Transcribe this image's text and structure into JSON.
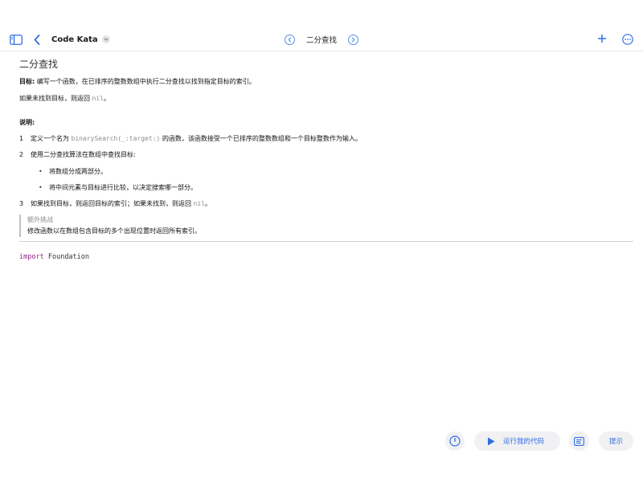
{
  "header": {
    "doc_title": "Code Kata",
    "page_name": "二分查找",
    "icons": [
      "sidebar-icon",
      "back-chevron-icon",
      "dropdown-chevron-icon",
      "previous-page-icon",
      "next-page-icon",
      "plus-icon",
      "more-icon"
    ]
  },
  "content": {
    "title": "二分查找",
    "goal_label": "目标:",
    "goal_text": " 编写一个函数，在已排序的整数数组中执行二分查找以找到指定目标的索引。",
    "not_found_prefix": "如果未找到目标，则返回 ",
    "not_found_code": "nil",
    "not_found_suffix": "。",
    "description_label": "说明:",
    "steps": [
      {
        "num": "1",
        "prefix": "定义一个名为 ",
        "code": "binarySearch(_:target:)",
        "suffix": " 的函数，该函数接受一个已排序的整数数组和一个目标整数作为输入。"
      },
      {
        "num": "2",
        "text": "使用二分查找算法在数组中查找目标:"
      },
      {
        "num": "3",
        "prefix": "如果找到目标，则返回目标的索引；如果未找到，则返回 ",
        "code": "nil",
        "suffix": "。"
      }
    ],
    "bullets": [
      "将数组分成两部分。",
      "将中间元素与目标进行比较，以决定搜索哪一部分。"
    ],
    "aside": {
      "title": "额外挑战",
      "text": "修改函数以在数组包含目标的多个出现位置时返回所有索引。"
    }
  },
  "code": {
    "keyword": "import",
    "module": "Foundation"
  },
  "footer": {
    "run_label": "运行我的代码",
    "hint_label": "提示",
    "accent_color": "#2f6fe4"
  }
}
